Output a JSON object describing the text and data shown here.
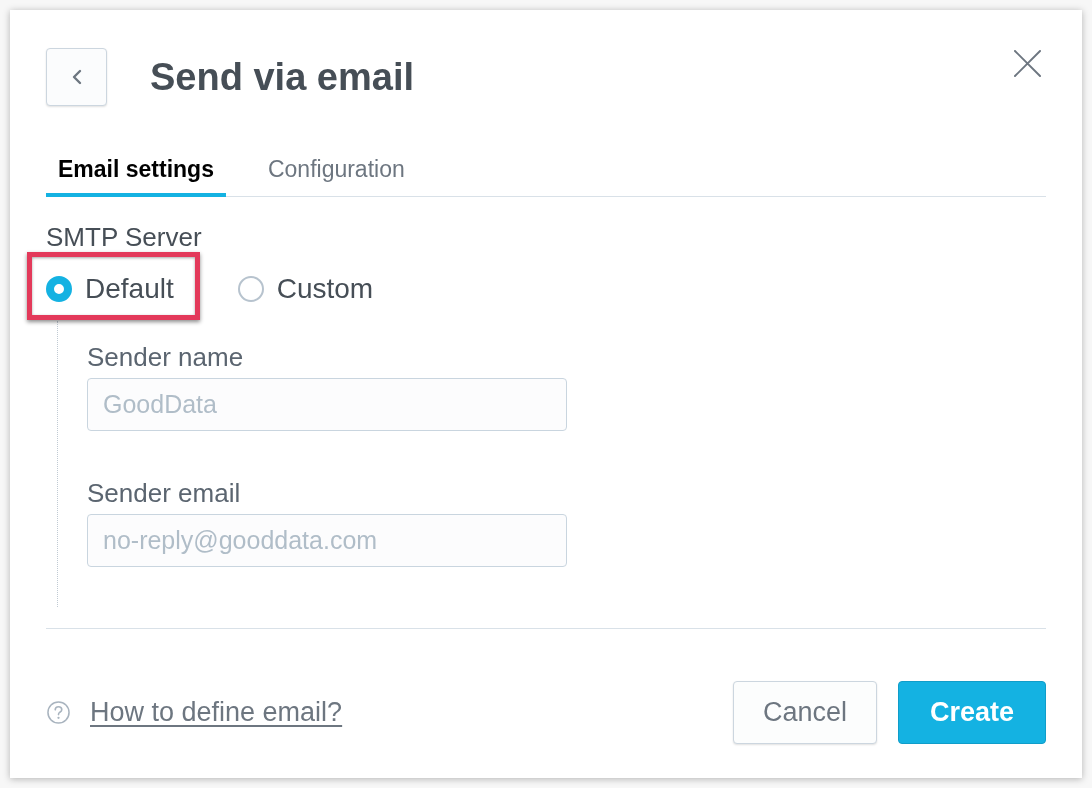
{
  "dialog": {
    "title": "Send via email"
  },
  "tabs": [
    {
      "label": "Email settings",
      "selected": true
    },
    {
      "label": "Configuration",
      "selected": false
    }
  ],
  "smtp_server": {
    "label": "SMTP Server",
    "options": [
      {
        "label": "Default",
        "selected": true,
        "highlighted": true
      },
      {
        "label": "Custom",
        "selected": false,
        "highlighted": false
      }
    ]
  },
  "fields": [
    {
      "label": "Sender name",
      "placeholder": "GoodData"
    },
    {
      "label": "Sender email",
      "placeholder": "no-reply@gooddata.com"
    }
  ],
  "footer": {
    "help_link": "How to define email?",
    "buttons": [
      {
        "label": "Cancel",
        "kind": "secondary"
      },
      {
        "label": "Create",
        "kind": "primary"
      }
    ]
  }
}
